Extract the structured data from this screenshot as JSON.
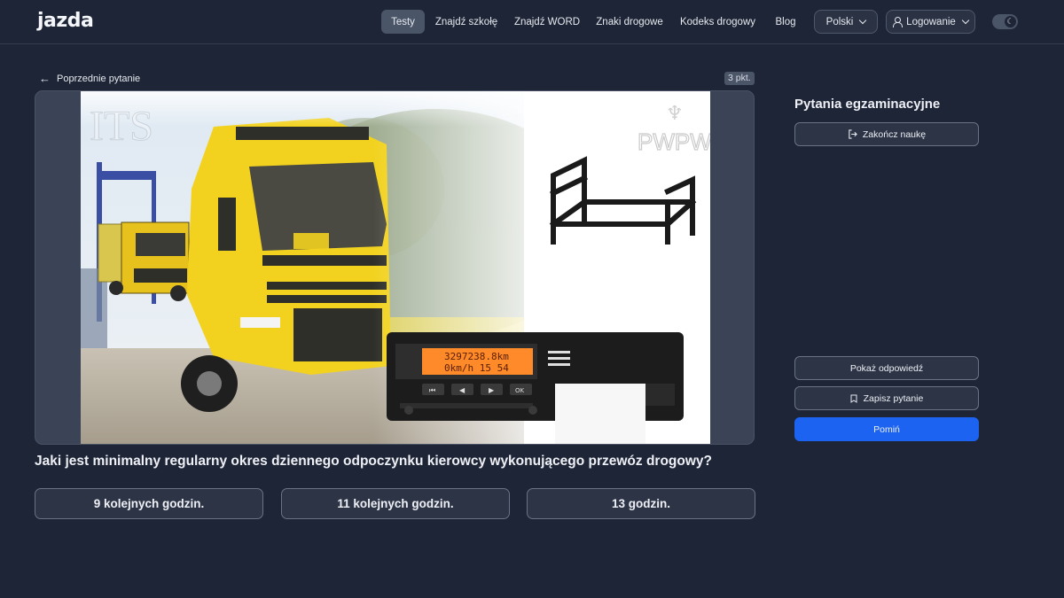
{
  "header": {
    "logo": "jazda",
    "nav": [
      {
        "label": "Testy",
        "active": true
      },
      {
        "label": "Znajdź szkołę"
      },
      {
        "label": "Znajdź WORD"
      },
      {
        "label": "Znaki drogowe"
      },
      {
        "label": "Kodeks drogowy"
      },
      {
        "label": "Blog"
      }
    ],
    "language": "Polski",
    "login": "Logowanie"
  },
  "main": {
    "back_label": "Poprzednie pytanie",
    "points": "3 pkt.",
    "image": {
      "watermark_left": "ITS",
      "watermark_right": "PWPW",
      "tachograph_line1": "3297238.8km",
      "tachograph_line2": "0km/h  15 54"
    },
    "question": "Jaki jest minimalny regularny okres dziennego odpoczynku kierowcy wykonującego przewóz drogowy?",
    "answers": [
      "9 kolejnych godzin.",
      "11 kolejnych godzin.",
      "13 godzin."
    ]
  },
  "sidebar": {
    "title": "Pytania egzaminacyjne",
    "finish": "Zakończ naukę",
    "show_answer": "Pokaż odpowiedź",
    "save": "Zapisz pytanie",
    "skip": "Pomiń"
  },
  "colors": {
    "background": "#1e2536",
    "accent": "#1b63f0",
    "truck_yellow": "#f2d21f",
    "display_orange": "#ff8a2a"
  }
}
